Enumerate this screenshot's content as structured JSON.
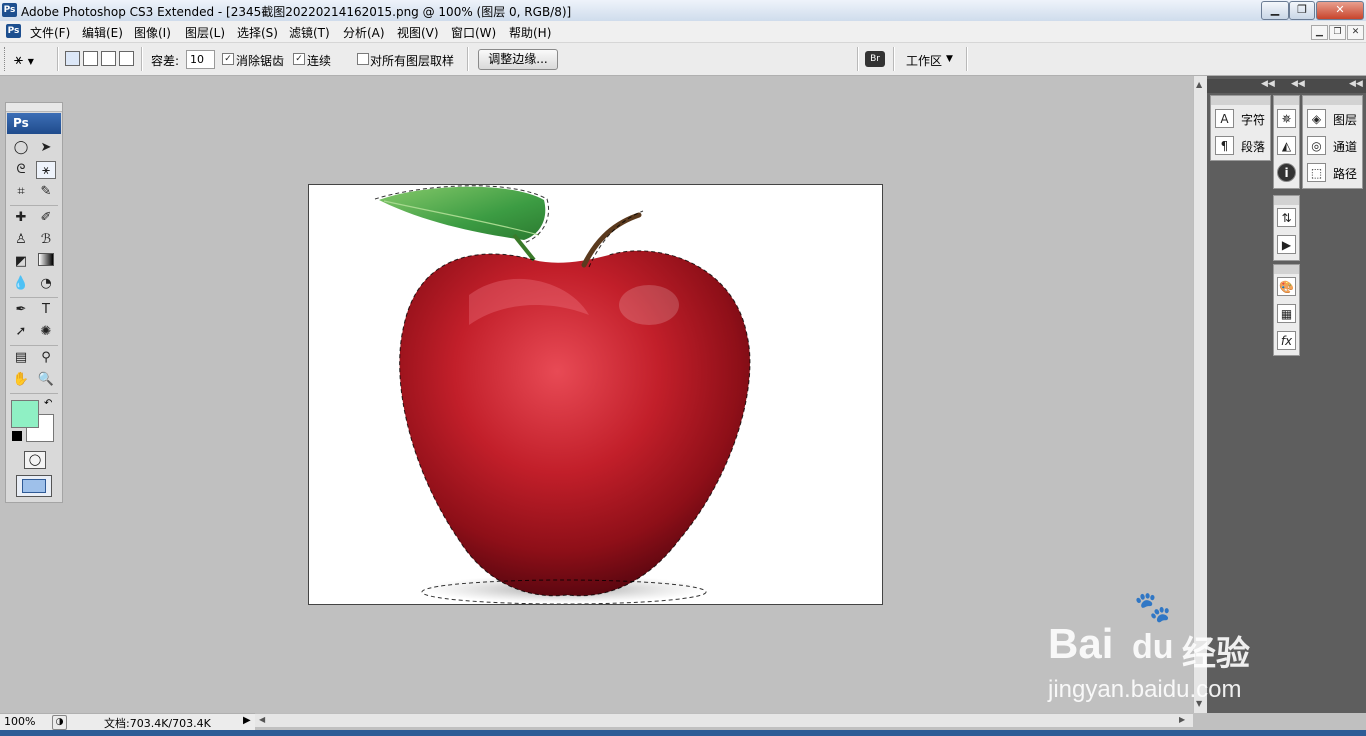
{
  "window": {
    "title": "Adobe Photoshop CS3 Extended - [2345截图20220214162015.png @ 100% (图层 0, RGB/8)]",
    "app_icon": "Ps"
  },
  "menu": {
    "items": [
      "文件(F)",
      "编辑(E)",
      "图像(I)",
      "图层(L)",
      "选择(S)",
      "滤镜(T)",
      "分析(A)",
      "视图(V)",
      "窗口(W)",
      "帮助(H)"
    ]
  },
  "options": {
    "tolerance_label": "容差:",
    "tolerance_value": "10",
    "anti_alias_label": "消除锯齿",
    "anti_alias_checked": true,
    "contiguous_label": "连续",
    "contiguous_checked": true,
    "sample_all_label": "对所有图层取样",
    "sample_all_checked": false,
    "refine_edge_label": "调整边缘...",
    "workspace_label": "工作区"
  },
  "toolbox": {
    "logo": "Ps",
    "foreground_color": "#8ff0c4",
    "background_color": "#ffffff"
  },
  "panels": {
    "group1": [
      "字符",
      "段落"
    ],
    "group3": [
      "图层",
      "通道",
      "路径"
    ]
  },
  "status": {
    "zoom": "100%",
    "doc_info": "文档:703.4K/703.4K"
  },
  "watermark": {
    "brand": "Bai",
    "brand2": "du",
    "brand_cn": "经验",
    "url": "jingyan.baidu.com"
  }
}
